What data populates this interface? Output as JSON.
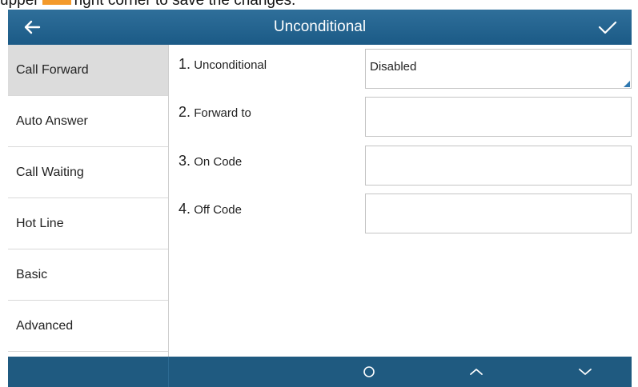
{
  "caption": {
    "before": "upper",
    "after": "right corner to save the changes."
  },
  "title_bar": {
    "title": "Unconditional",
    "back_icon": "arrow-left-icon",
    "save_icon": "checkmark-icon"
  },
  "sidebar": {
    "items": [
      {
        "label": "Call Forward",
        "active": true
      },
      {
        "label": "Auto Answer"
      },
      {
        "label": "Call Waiting"
      },
      {
        "label": "Hot Line"
      },
      {
        "label": "Basic"
      },
      {
        "label": "Advanced"
      }
    ]
  },
  "fields": [
    {
      "num": "1.",
      "label": "Unconditional",
      "value": "Disabled",
      "type": "dropdown"
    },
    {
      "num": "2.",
      "label": "Forward to",
      "value": ""
    },
    {
      "num": "3.",
      "label": "On Code",
      "value": ""
    },
    {
      "num": "4.",
      "label": "Off Code",
      "value": ""
    }
  ],
  "softkeys": {
    "icons": [
      "circle-icon",
      "chevron-up-icon",
      "chevron-down-icon"
    ]
  },
  "colors": {
    "title_bar": "#2f6f9a",
    "bottom_bar": "#1f5a80",
    "active_item": "#dcdcdc",
    "highlight": "#f39a2c"
  }
}
